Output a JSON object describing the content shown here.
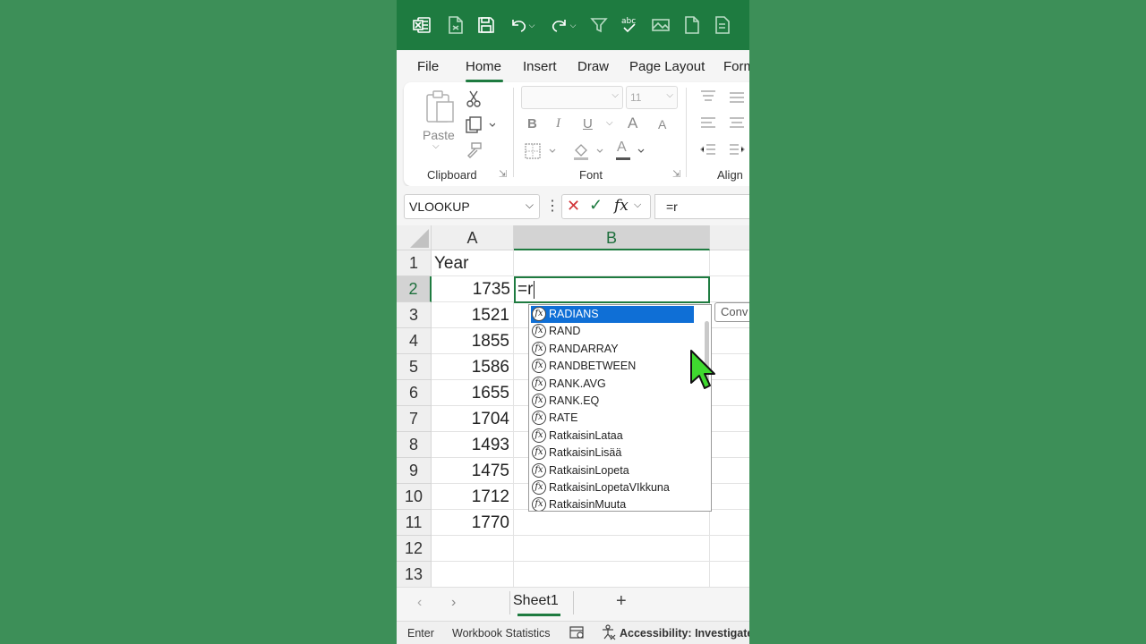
{
  "quick_access": {
    "icons": [
      "excel-logo-icon",
      "autosave-icon",
      "save-icon",
      "undo-icon",
      "redo-icon",
      "filter-icon",
      "spelling-icon",
      "image-icon",
      "new-file-icon",
      "form-icon"
    ]
  },
  "tabs": [
    "File",
    "Home",
    "Insert",
    "Draw",
    "Page Layout",
    "Form"
  ],
  "active_tab": "Home",
  "ribbon": {
    "clipboard": {
      "paste_label": "Paste",
      "group_label": "Clipboard"
    },
    "font": {
      "font_size": "11",
      "bold": "B",
      "italic": "I",
      "underline": "U",
      "grow": "A",
      "shrink": "A",
      "font_color": "A",
      "group_label": "Font"
    },
    "alignment": {
      "group_label": "Align"
    }
  },
  "formula_bar": {
    "name_box": "VLOOKUP",
    "fx_label": "fx",
    "formula": "=r"
  },
  "columns": [
    "A",
    "B"
  ],
  "selected_column": "B",
  "rows": [
    {
      "num": "1",
      "a": "Year"
    },
    {
      "num": "2",
      "a": "1735"
    },
    {
      "num": "3",
      "a": "1521"
    },
    {
      "num": "4",
      "a": "1855"
    },
    {
      "num": "5",
      "a": "1586"
    },
    {
      "num": "6",
      "a": "1655"
    },
    {
      "num": "7",
      "a": "1704"
    },
    {
      "num": "8",
      "a": "1493"
    },
    {
      "num": "9",
      "a": "1475"
    },
    {
      "num": "10",
      "a": "1712"
    },
    {
      "num": "11",
      "a": "1770"
    },
    {
      "num": "12",
      "a": ""
    },
    {
      "num": "13",
      "a": ""
    }
  ],
  "active_cell": {
    "ref": "B2",
    "value": "=r"
  },
  "autocomplete": {
    "selected": "RADIANS",
    "items": [
      "RADIANS",
      "RAND",
      "RANDARRAY",
      "RANDBETWEEN",
      "RANK.AVG",
      "RANK.EQ",
      "RATE",
      "RatkaisinLataa",
      "RatkaisinLisää",
      "RatkaisinLopeta",
      "RatkaisinLopetaVIkkuna",
      "RatkaisinMuuta"
    ],
    "icon": "fx"
  },
  "tooltip": "Conv",
  "sheet_tab": "Sheet1",
  "status_bar": {
    "mode": "Enter",
    "workbook_stats": "Workbook Statistics",
    "accessibility": "Accessibility: Investigate"
  },
  "colors": {
    "accent": "#1e7b40",
    "background": "#3d8f58",
    "selection": "#0f6fd6"
  }
}
